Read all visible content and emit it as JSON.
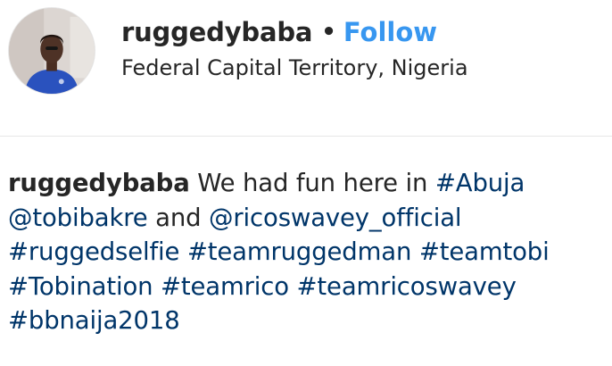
{
  "post_header": {
    "username": "ruggedybaba",
    "separator": "•",
    "follow_label": "Follow",
    "location": "Federal Capital Territory, Nigeria"
  },
  "caption": {
    "username": "ruggedybaba",
    "text_1": "We had fun here in",
    "hashtag_abuja": "#Abuja",
    "mention_1": "@tobibakre",
    "text_2": "and",
    "mention_2": "@ricoswavey_official",
    "hashtag_ruggedselfie": "#ruggedselfie",
    "hashtag_teamruggedman": "#teamruggedman",
    "hashtag_teamtobi": "#teamtobi",
    "hashtag_tobination": "#Tobination",
    "hashtag_teamrico": "#teamrico",
    "hashtag_teamricoswavey": "#teamricoswavey",
    "hashtag_bbnaija2018": "#bbnaija2018"
  },
  "colors": {
    "follow": "#3897f0",
    "link": "#003569",
    "text": "#262626",
    "divider": "#e6e6e6"
  }
}
